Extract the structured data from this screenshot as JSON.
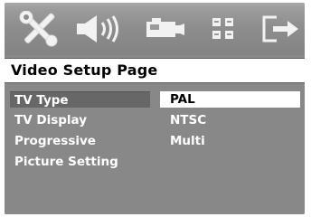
{
  "toolbar": {
    "icons": [
      {
        "name": "general-setup-icon"
      },
      {
        "name": "audio-setup-icon"
      },
      {
        "name": "video-setup-icon"
      },
      {
        "name": "preference-setup-icon"
      },
      {
        "name": "exit-icon"
      }
    ]
  },
  "page": {
    "title": "Video Setup Page"
  },
  "menu": {
    "items": [
      {
        "label": "TV Type",
        "selected": true
      },
      {
        "label": "TV Display",
        "selected": false
      },
      {
        "label": "Progressive",
        "selected": false
      },
      {
        "label": "Picture Setting",
        "selected": false
      }
    ]
  },
  "options": {
    "items": [
      {
        "label": "PAL",
        "selected": true
      },
      {
        "label": "NTSC",
        "selected": false
      },
      {
        "label": "Multi",
        "selected": false
      }
    ]
  },
  "colors": {
    "panel": "#888888",
    "selected_menu": "#676767",
    "selected_option": "#ffffff",
    "text": "#ffffff"
  }
}
